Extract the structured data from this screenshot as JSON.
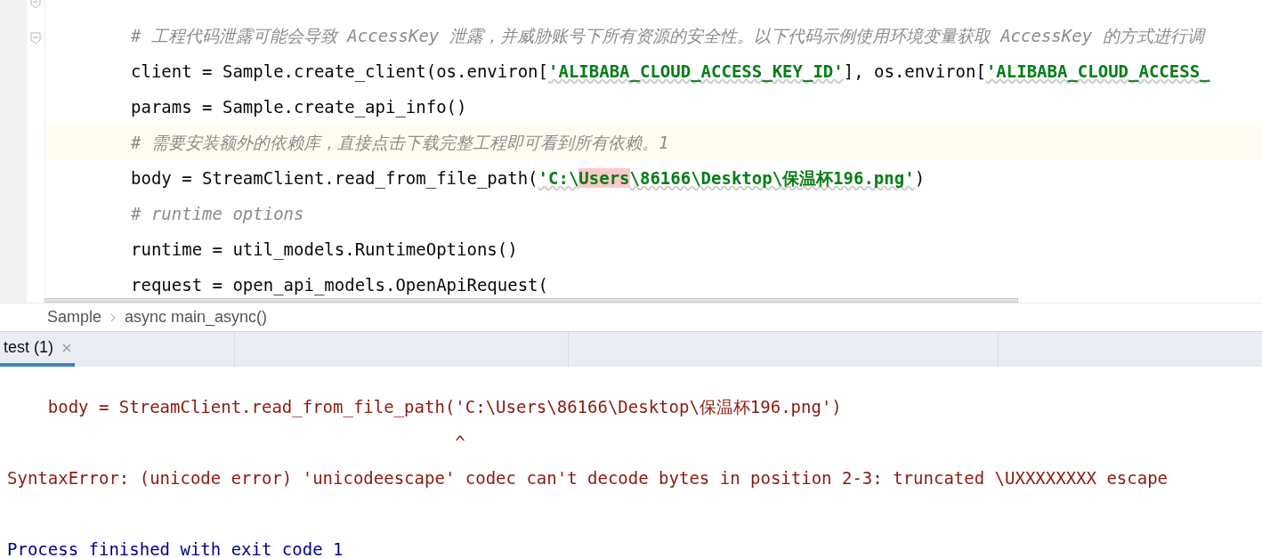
{
  "editor": {
    "lines": [
      {
        "current": false,
        "segments": [
          {
            "kind": "comment",
            "text": "# 工程代码泄露可能会导致 AccessKey 泄露，并威胁账号下所有资源的安全性。以下代码示例使用环境变量获取 AccessKey 的方式进行调"
          }
        ]
      },
      {
        "current": false,
        "segments": [
          {
            "kind": "plain",
            "text": "client = Sample.create_client(os.environ["
          },
          {
            "kind": "string",
            "text": "'ALIBABA_CLOUD_ACCESS_KEY_ID'"
          },
          {
            "kind": "plain",
            "text": "], os.environ["
          },
          {
            "kind": "string",
            "text": "'ALIBABA_CLOUD_ACCESS_"
          }
        ]
      },
      {
        "current": false,
        "segments": [
          {
            "kind": "plain",
            "text": "params = Sample.create_api_info()"
          }
        ]
      },
      {
        "current": true,
        "segments": [
          {
            "kind": "comment",
            "text": "# 需要安装额外的依赖库，直接点击下载完整工程即可看到所有依赖。1"
          }
        ]
      },
      {
        "current": false,
        "segments": [
          {
            "kind": "plain",
            "text": "body = StreamClient.read_from_file_path("
          },
          {
            "kind": "string",
            "text": "'C:\\"
          },
          {
            "kind": "string_highlight",
            "text": "Users"
          },
          {
            "kind": "string",
            "text": "\\86166\\Desktop\\保温杯196.png'"
          },
          {
            "kind": "plain",
            "text": ")"
          }
        ]
      },
      {
        "current": false,
        "segments": [
          {
            "kind": "comment",
            "text": "# runtime options"
          }
        ]
      },
      {
        "current": false,
        "segments": [
          {
            "kind": "plain",
            "text": "runtime = util_models.RuntimeOptions()"
          }
        ]
      },
      {
        "current": false,
        "segments": [
          {
            "kind": "plain",
            "text": "request = open_api_models.OpenApiRequest("
          }
        ]
      }
    ]
  },
  "breadcrumb": [
    "Sample",
    "async main_async()"
  ],
  "tabs": [
    {
      "label": "test (1)",
      "selected": true
    }
  ],
  "console": {
    "lines": [
      {
        "kind": "trace",
        "segments": [
          {
            "kind": "error",
            "text": "    body = StreamClient.read_from_file_path('C:\\Users\\86166\\Desktop\\保温杯196.png')"
          }
        ]
      },
      {
        "kind": "trace",
        "segments": [
          {
            "kind": "error",
            "text": "                                            ^"
          }
        ]
      },
      {
        "kind": "trace",
        "segments": [
          {
            "kind": "error",
            "text": "SyntaxError: (unicode error) 'unicodeescape' codec can't decode bytes in position 2-3: truncated \\UXXXXXXXX escape"
          }
        ]
      },
      {
        "kind": "status",
        "segments": [
          {
            "kind": "info",
            "text": "Process finished with exit code 1"
          }
        ]
      }
    ]
  }
}
